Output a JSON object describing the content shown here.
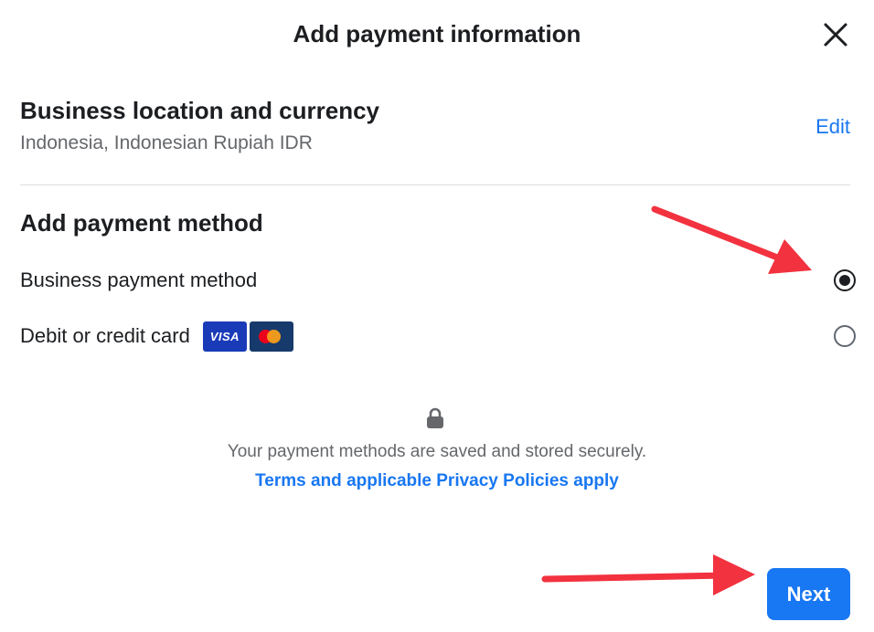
{
  "dialog": {
    "title": "Add payment information",
    "close_icon": "close-icon"
  },
  "business_location": {
    "heading": "Business location and currency",
    "value": "Indonesia, Indonesian Rupiah IDR",
    "edit_label": "Edit"
  },
  "payment_method": {
    "heading": "Add payment method",
    "options": [
      {
        "label": "Business payment method",
        "selected": true
      },
      {
        "label": "Debit or credit card",
        "selected": false,
        "card_logos": [
          "VISA",
          "mastercard"
        ]
      }
    ]
  },
  "security": {
    "icon": "lock-icon",
    "message": "Your payment methods are saved and stored securely.",
    "terms_link": "Terms and applicable Privacy Policies apply"
  },
  "footer": {
    "next_label": "Next"
  },
  "colors": {
    "accent": "#1877f2",
    "annotation_arrow": "#f2323f"
  }
}
